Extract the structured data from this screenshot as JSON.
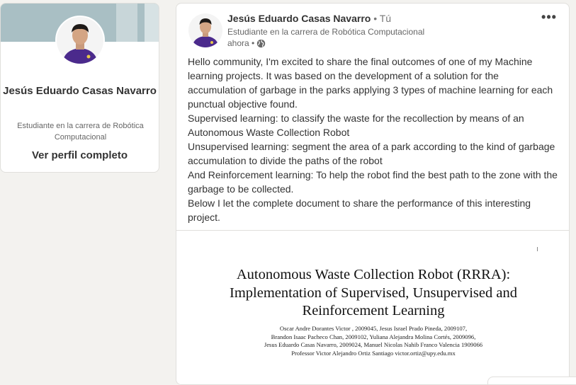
{
  "profile": {
    "name": "Jesús Eduardo Casas Navarro",
    "headline": "Estudiante en la carrera de Robótica Computacional",
    "view_profile_label": "Ver perfil completo"
  },
  "post": {
    "author_name": "Jesús Eduardo Casas Navarro",
    "connection_degree": " • Tú",
    "author_headline": "Estudiante en la carrera de Robótica Computacional",
    "time": "ahora •",
    "visibility_icon": "globe-icon",
    "more_label": "•••",
    "paragraphs": [
      "Hello community, I'm excited to share the final outcomes of one of my Machine learning projects. It was based on the development of a solution for the accumulation of garbage in the parks applying 3 types of machine learning for each punctual objective found.",
      "Supervised learning: to classify the waste for the recollection by means of an Autonomous Waste Collection Robot",
      "Unsupervised learning: segment the area of a park according to the kind of garbage accumulation to divide the paths of the robot",
      "And Reinforcement learning: To help the robot find the best path to the zone with the garbage to be collected.",
      "Below I let the complete document to share the performance of this interesting project."
    ]
  },
  "document": {
    "title": "Autonomous Waste Collection Robot (RRRA): Implementation of Supervised, Unsupervised and Reinforcement Learning",
    "author_lines": [
      "Oscar Andre Dorantes Victor , 2009045, Jesus Israel Prado Pineda, 2009107,",
      "Brandon Isaac Pacheco Chan, 2009102, Yuliana Alejandra Molina Cortés, 2009096,",
      "Jesus Eduardo Casas Navarro, 2009024, Manuel Nicolas Nahib Franco Valencia 1909066",
      "Professor Victor Alejandro Ortiz Santiago victor.ortiz@upy.edu.mx"
    ]
  }
}
